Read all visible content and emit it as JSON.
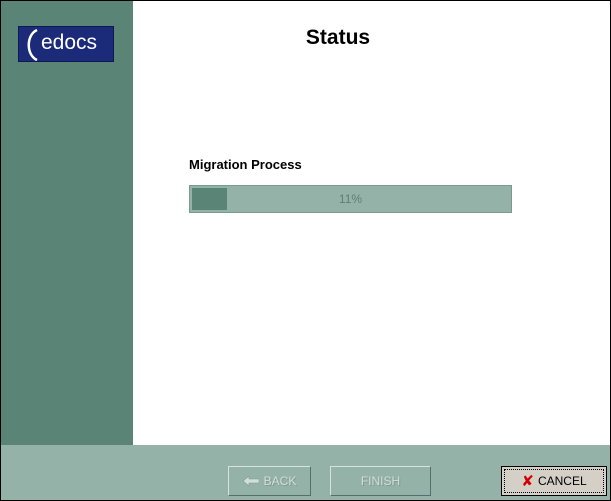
{
  "logo": {
    "text": "edocs"
  },
  "page": {
    "title": "Status"
  },
  "migration": {
    "label": "Migration Process",
    "progress_fraction": 0.11,
    "progress_text": "11%"
  },
  "buttons": {
    "back": "BACK",
    "finish": "FINISH",
    "cancel": "CANCEL"
  },
  "icons": {
    "back": "arrow-left-icon",
    "cancel": "red-x-icon"
  },
  "colors": {
    "sidebar": "#5a8476",
    "footer": "#95b2a8",
    "progress_track": "#95b2a8",
    "progress_fill": "#5a8476",
    "logo_bg": "#1c2a7a",
    "cancel_x": "#d40000"
  }
}
